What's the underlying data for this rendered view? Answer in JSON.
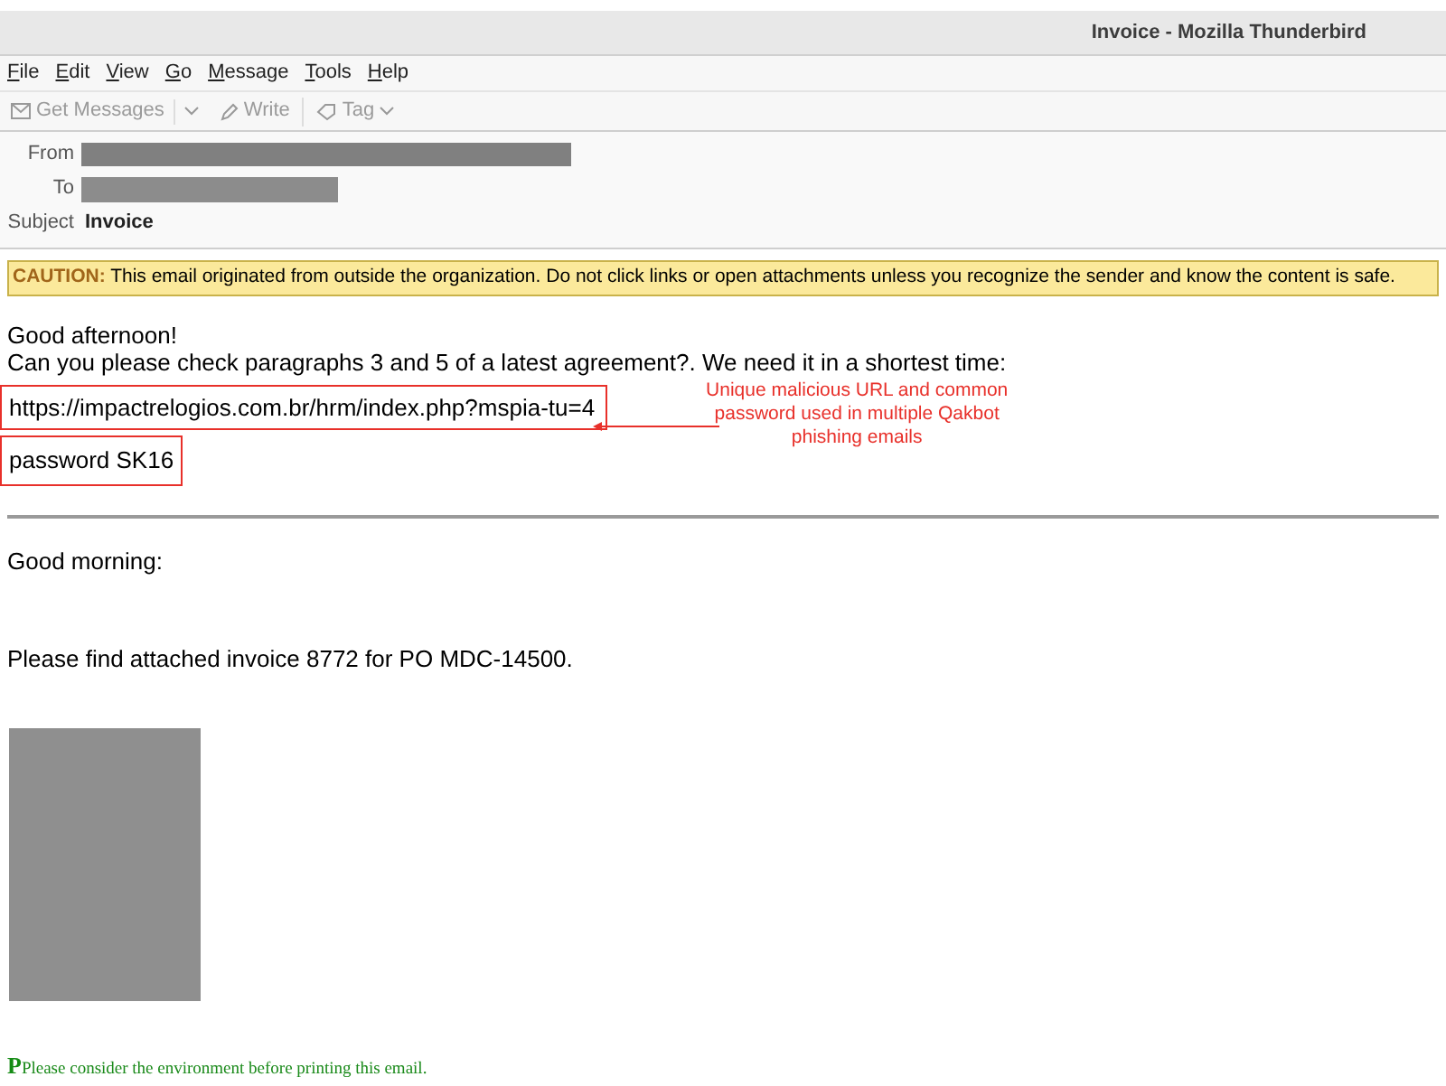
{
  "window": {
    "title": "Invoice - Mozilla Thunderbird"
  },
  "menu": [
    "File",
    "Edit",
    "View",
    "Go",
    "Message",
    "Tools",
    "Help"
  ],
  "toolbar": [
    {
      "kind": "get",
      "label": "Get Messages",
      "disabled": true
    },
    {
      "kind": "write",
      "label": "Write",
      "disabled": true
    },
    {
      "kind": "tag",
      "label": "Tag",
      "disabled": true
    }
  ],
  "header": {
    "from_label": "From",
    "to_label": "To",
    "subject_label": "Subject",
    "subject": "Invoice"
  },
  "caution": {
    "label": "CAUTION:",
    "text": "This email originated from outside the organization. Do not click links or open attachments unless you recognize the sender and know the content is safe."
  },
  "body": {
    "greeting": "Good afternoon!",
    "request": "Can you please check paragraphs 3 and 5 of a latest agreement?. We need it in a shortest time:",
    "url": "https://impactrelogios.com.br/hrm/index.php?mspia-tu=4",
    "password": "password SK16",
    "annotation": "Unique malicious URL and common password used in multiple Qakbot phishing emails"
  },
  "quoted": {
    "greeting": "Good morning:",
    "text": "Please find attached invoice 8772 for PO MDC-14500."
  },
  "footer": {
    "mark": "P",
    "text": "Please consider the environment before printing this email."
  }
}
